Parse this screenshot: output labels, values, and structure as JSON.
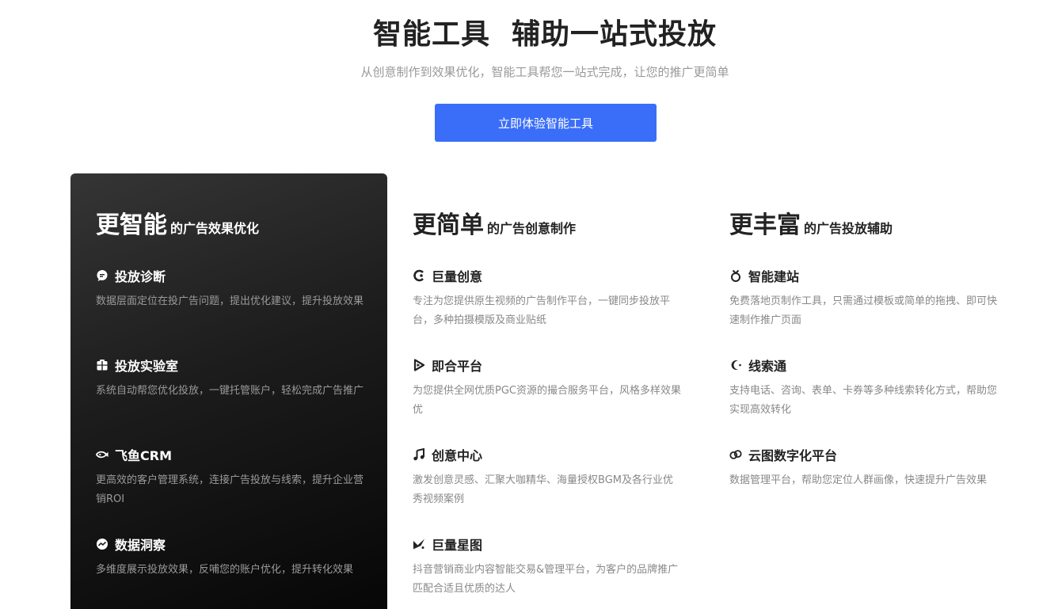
{
  "hero": {
    "title": "智能工具  辅助一站式投放",
    "subtitle": "从创意制作到效果优化，智能工具帮您一站式完成，让您的推广更简单",
    "cta_label": "立即体验智能工具"
  },
  "columns": [
    {
      "big": "更智能",
      "small": "的广告效果优化",
      "items": [
        {
          "icon": "chat-bubble-icon",
          "title": "投放诊断",
          "desc": "数据层面定位在投广告问题，提出优化建议，提升投放效果"
        },
        {
          "icon": "lab-box-icon",
          "title": "投放实验室",
          "desc": "系统自动帮您优化投放，一键托管账户，轻松完成广告推广"
        },
        {
          "icon": "fish-icon",
          "title": "飞鱼CRM",
          "desc": "更高效的客户管理系统，连接广告投放与线索，提升企业营销ROI"
        },
        {
          "icon": "insight-chart-icon",
          "title": "数据洞察",
          "desc": "多维度展示投放效果，反哺您的账户优化，提升转化效果"
        }
      ]
    },
    {
      "big": "更简单",
      "small": "的广告创意制作",
      "items": [
        {
          "icon": "c-logo-icon",
          "title": "巨量创意",
          "desc": "专注为您提供原生视频的广告制作平台，一键同步投放平台，多种拍摄模版及商业贴纸"
        },
        {
          "icon": "play-icon",
          "title": "即合平台",
          "desc": "为您提供全网优质PGC资源的撮合服务平台，风格多样效果优"
        },
        {
          "icon": "music-note-icon",
          "title": "创意中心",
          "desc": "激发创意灵感、汇聚大咖精华、海量授权BGM及各行业优秀视频案例"
        },
        {
          "icon": "star-logo-icon",
          "title": "巨量星图",
          "desc": "抖音营销商业内容智能交易&管理平台，为客户的品牌推广匹配合适且优质的达人"
        }
      ]
    },
    {
      "big": "更丰富",
      "small": "的广告投放辅助",
      "items": [
        {
          "icon": "site-builder-icon",
          "title": "智能建站",
          "desc": "免费落地页制作工具，只需通过模板或简单的拖拽、即可快速制作推广页面"
        },
        {
          "icon": "moon-clue-icon",
          "title": "线索通",
          "desc": "支持电话、咨询、表单、卡券等多种线索转化方式，帮助您实现高效转化"
        },
        {
          "icon": "cloud-link-icon",
          "title": "云图数字化平台",
          "desc": "数据管理平台，帮助您定位人群画像，快速提升广告效果"
        }
      ]
    }
  ]
}
